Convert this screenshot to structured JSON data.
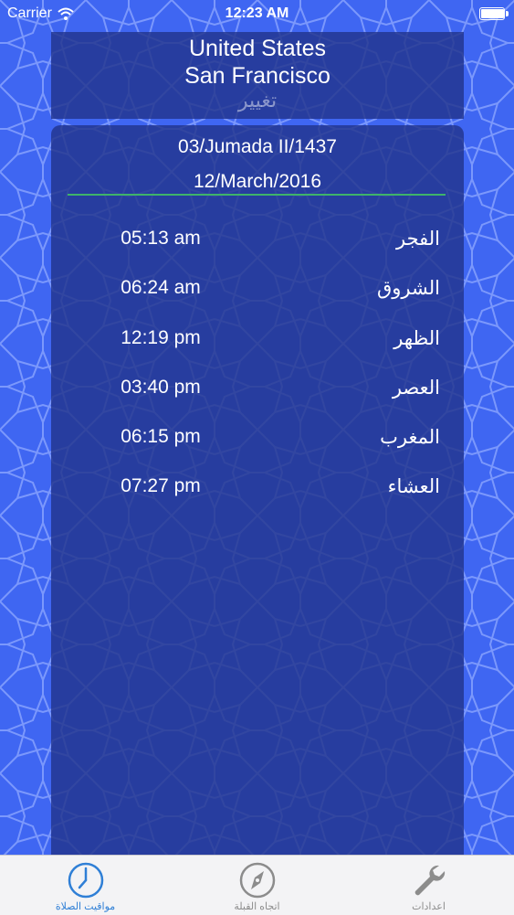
{
  "status_bar": {
    "carrier": "Carrier",
    "time": "12:23 AM",
    "battery_level": 0.95
  },
  "location": {
    "country": "United States",
    "city": "San Francisco",
    "change_label": "تغيير"
  },
  "dates": {
    "hijri": "03/Jumada II/1437",
    "gregorian": "12/March/2016"
  },
  "prayers": [
    {
      "name": "الفجر",
      "time": "05:13 am"
    },
    {
      "name": "الشروق",
      "time": "06:24 am"
    },
    {
      "name": "الظهر",
      "time": "12:19 pm"
    },
    {
      "name": "العصر",
      "time": "03:40 pm"
    },
    {
      "name": "المغرب",
      "time": "06:15 pm"
    },
    {
      "name": "العشاء",
      "time": "07:27 pm"
    }
  ],
  "tabs": [
    {
      "label": "مواقيت الصلاة",
      "icon": "clock-icon",
      "active": true
    },
    {
      "label": "اتجاه القبلة",
      "icon": "compass-icon",
      "active": false
    },
    {
      "label": "اعدادات",
      "icon": "wrench-icon",
      "active": false
    }
  ],
  "colors": {
    "background": "#3f66f2",
    "panel": "#22348c",
    "divider": "#3fb36a",
    "tab_active": "#2f7fd6",
    "tab_inactive": "#8c8c8c"
  }
}
